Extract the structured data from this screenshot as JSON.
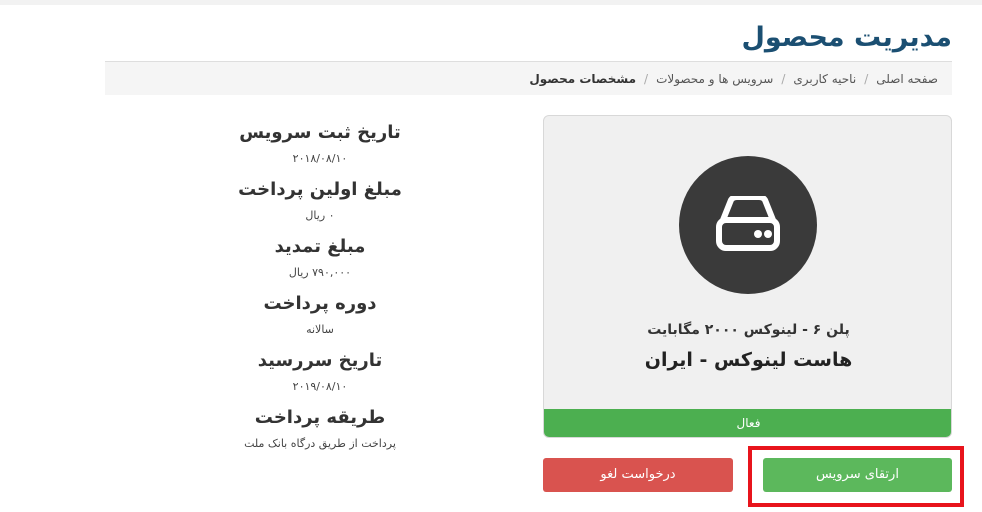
{
  "page": {
    "title": "مدیریت محصول"
  },
  "breadcrumb": {
    "items": [
      "صفحه اصلی",
      "ناحیه کاربری",
      "سرویس ها و محصولات"
    ],
    "active": "مشخصات محصول",
    "separator": "/"
  },
  "product": {
    "icon": "server-drive-icon",
    "plan": "پلن ۶ - لینوکس ۲۰۰۰ مگابایت",
    "name": "هاست لینوکس - ایران",
    "status": "فعال"
  },
  "actions": {
    "upgrade_label": "ارتقای سرویس",
    "cancel_label": "درخواست لغو"
  },
  "details": [
    {
      "label": "تاریخ ثبت سرویس",
      "value": "۲۰۱۸/۰۸/۱۰"
    },
    {
      "label": "مبلغ اولین پرداخت",
      "value": "۰ ریال"
    },
    {
      "label": "مبلغ تمدید",
      "value": "۷۹۰,۰۰۰ ریال"
    },
    {
      "label": "دوره پرداخت",
      "value": "سالانه"
    },
    {
      "label": "تاریخ سررسید",
      "value": "۲۰۱۹/۰۸/۱۰"
    },
    {
      "label": "طریقه پرداخت",
      "value": "پرداخت از طریق درگاه بانک ملت"
    }
  ],
  "colors": {
    "title": "#1b4f72",
    "status_active": "#4caf50",
    "upgrade": "#5cb85c",
    "cancel": "#d9534f",
    "highlight": "#e8141c"
  }
}
